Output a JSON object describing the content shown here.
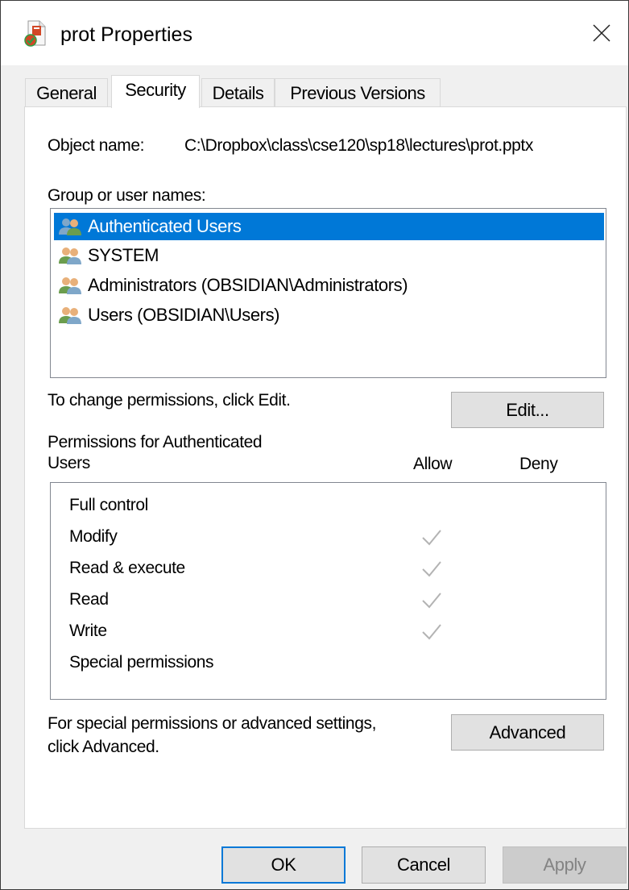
{
  "window": {
    "title": "prot Properties"
  },
  "tabs": [
    {
      "label": "General",
      "active": false
    },
    {
      "label": "Security",
      "active": true
    },
    {
      "label": "Details",
      "active": false
    },
    {
      "label": "Previous Versions",
      "active": false
    }
  ],
  "security": {
    "object_label": "Object name:",
    "object_value": "C:\\Dropbox\\class\\cse120\\sp18\\lectures\\prot.pptx",
    "group_label": "Group or user names:",
    "users": [
      {
        "name": "Authenticated Users",
        "selected": true,
        "icon": "users-group-blue-icon"
      },
      {
        "name": "SYSTEM",
        "selected": false,
        "icon": "users-group-icon"
      },
      {
        "name": "Administrators (OBSIDIAN\\Administrators)",
        "selected": false,
        "icon": "users-group-icon"
      },
      {
        "name": "Users (OBSIDIAN\\Users)",
        "selected": false,
        "icon": "users-group-icon"
      }
    ],
    "change_text": "To change permissions, click Edit.",
    "edit_button": "Edit...",
    "permissions_header_line1": "Permissions for Authenticated",
    "permissions_header_line2": "Users",
    "allow_header": "Allow",
    "deny_header": "Deny",
    "permissions": [
      {
        "name": "Full control",
        "allow": false,
        "deny": false
      },
      {
        "name": "Modify",
        "allow": true,
        "deny": false
      },
      {
        "name": "Read & execute",
        "allow": true,
        "deny": false
      },
      {
        "name": "Read",
        "allow": true,
        "deny": false
      },
      {
        "name": "Write",
        "allow": true,
        "deny": false
      },
      {
        "name": "Special permissions",
        "allow": false,
        "deny": false
      }
    ],
    "special_text_line1": "For special permissions or advanced settings,",
    "special_text_line2": "click Advanced.",
    "advanced_button": "Advanced"
  },
  "footer": {
    "ok": "OK",
    "cancel": "Cancel",
    "apply": "Apply"
  },
  "colors": {
    "selection": "#0078d7",
    "check": "#b3b3b3",
    "primary_border": "#0078d7"
  }
}
